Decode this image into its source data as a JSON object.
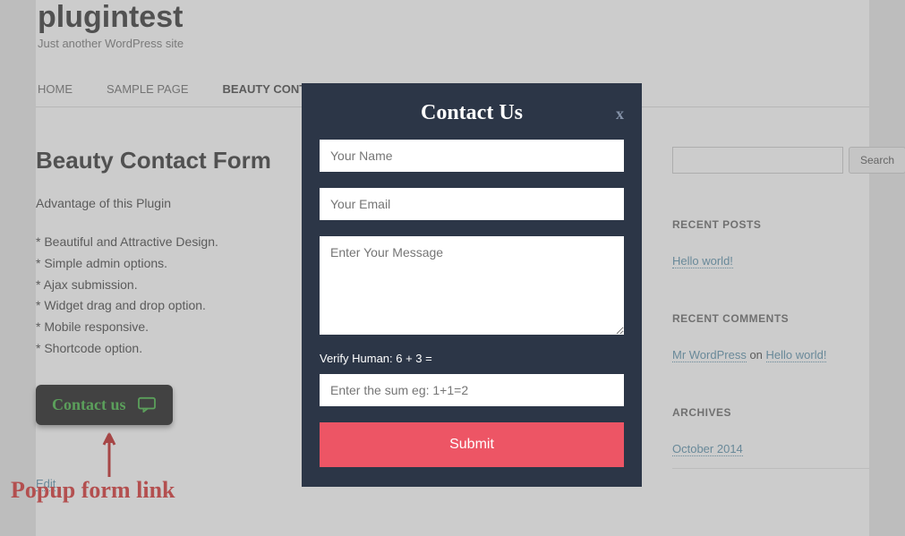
{
  "site": {
    "title": "plugintest",
    "tagline": "Just another WordPress site"
  },
  "nav": {
    "items": [
      {
        "label": "HOME"
      },
      {
        "label": "SAMPLE PAGE"
      },
      {
        "label": "BEAUTY CONTACT FORM"
      }
    ]
  },
  "main": {
    "heading": "Beauty Contact Form",
    "intro": "Advantage of this Plugin",
    "features": [
      "* Beautiful and Attractive Design.",
      "* Simple admin options.",
      "* Ajax submission.",
      "* Widget drag and drop option.",
      "* Mobile responsive.",
      "* Shortcode option."
    ],
    "contact_button": "Contact us",
    "edit": "Edit",
    "annotation": "Popup form link"
  },
  "sidebar": {
    "search_button": "Search",
    "recent_posts": {
      "title": "RECENT POSTS",
      "items": [
        "Hello world!"
      ]
    },
    "recent_comments": {
      "title": "RECENT COMMENTS",
      "author": "Mr WordPress",
      "on": " on ",
      "post": "Hello world!"
    },
    "archives": {
      "title": "ARCHIVES",
      "items": [
        "October 2014"
      ]
    }
  },
  "modal": {
    "title": "Contact Us",
    "close": "x",
    "name_placeholder": "Your Name",
    "email_placeholder": "Your Email",
    "message_placeholder": "Enter Your Message",
    "verify_label": "Verify Human: 6 + 3 =",
    "verify_placeholder": "Enter the sum eg: 1+1=2",
    "submit": "Submit"
  }
}
